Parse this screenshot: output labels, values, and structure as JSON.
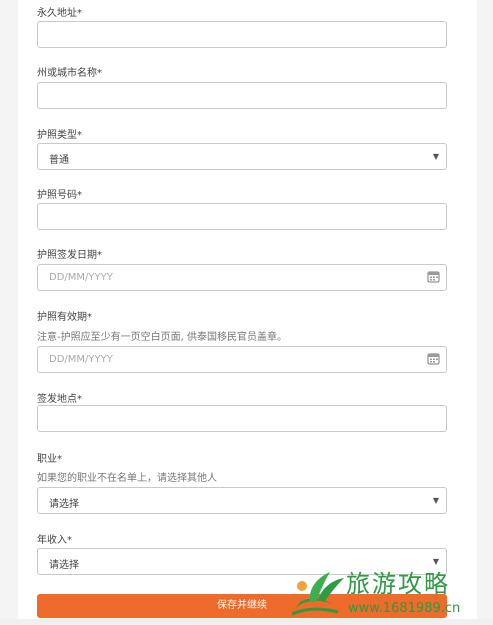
{
  "form": {
    "permanent_address": {
      "label": "永久地址*",
      "value": ""
    },
    "state_city": {
      "label": "州或城市名称*",
      "value": ""
    },
    "passport_type": {
      "label": "护照类型*",
      "value": "普通"
    },
    "passport_number": {
      "label": "护照号码*",
      "value": ""
    },
    "issue_date": {
      "label": "护照签发日期*",
      "placeholder": "DD/MM/YYYY"
    },
    "expiry_date": {
      "label": "护照有效期*",
      "note": "注意-护照应至少有一页空白页面, 供泰国移民官员盖章。",
      "placeholder": "DD/MM/YYYY"
    },
    "issue_place": {
      "label": "签发地点*",
      "value": ""
    },
    "occupation": {
      "label": "职业*",
      "note": "如果您的职业不在名单上，请选择其他人",
      "value": "请选择"
    },
    "annual_income": {
      "label": "年收入*",
      "value": "请选择"
    },
    "submit_label": "保存并继续"
  },
  "watermark": {
    "title": "旅游攻略",
    "url": "www.1681989.cn"
  },
  "colors": {
    "accent": "#ee6b2b",
    "watermark": "#2e9a42",
    "border": "#c9c9c9"
  },
  "icons": {
    "dropdown": "chevron-down-icon",
    "date": "calendar-icon"
  }
}
